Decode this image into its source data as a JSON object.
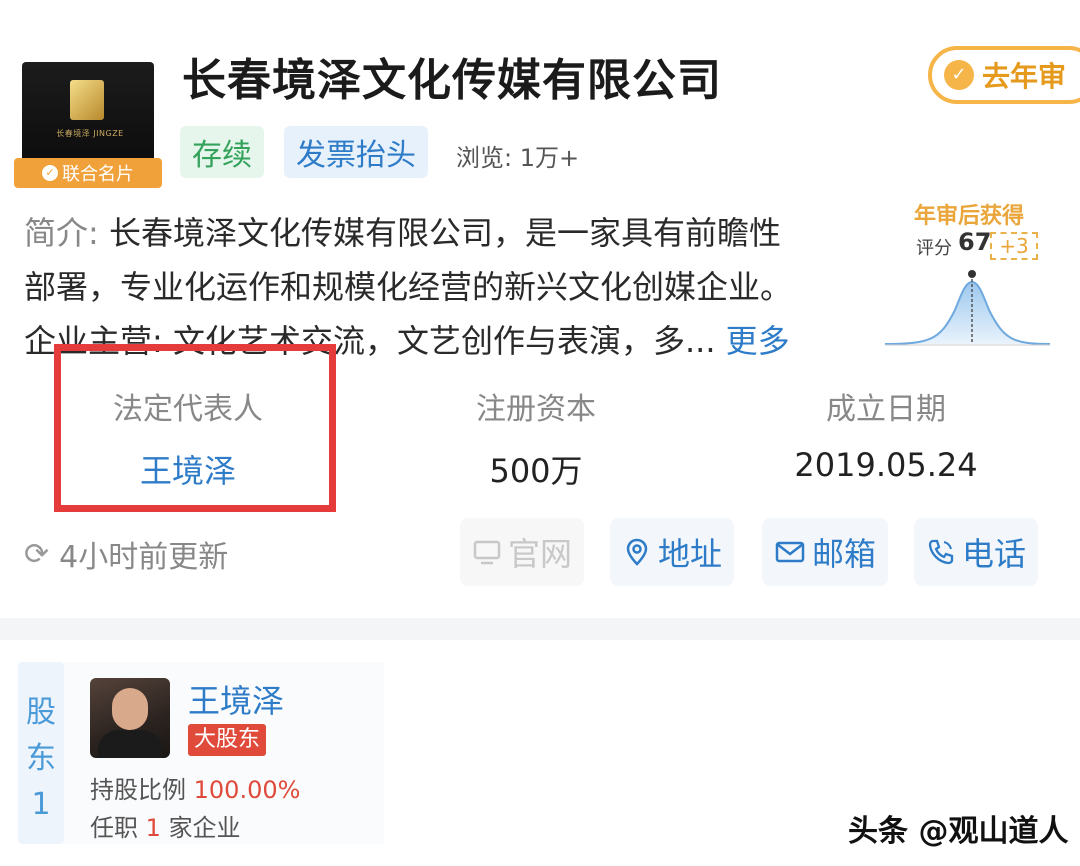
{
  "company": {
    "name": "长春境泽文化传媒有限公司",
    "logo_badge": "联合名片",
    "audit_badge": "去年审",
    "status_tag": "存续",
    "invoice_tag": "发票抬头",
    "views": "浏览: 1万+"
  },
  "intro": {
    "label": "简介:",
    "line1": "长春境泽文化传媒有限公司，是一家具有前瞻性",
    "line2": "部署，专业化运作和规模化经营的新兴文化创媒企业。",
    "line3_label": "企业主营:",
    "line3": "文化艺术交流，文艺创作与表演，多...",
    "more": "更多"
  },
  "score": {
    "title": "年审后获得",
    "label": "评分",
    "value": "67",
    "delta": "+3"
  },
  "stats": {
    "legal_rep_label": "法定代表人",
    "legal_rep_value": "王境泽",
    "capital_label": "注册资本",
    "capital_value": "500万",
    "founded_label": "成立日期",
    "founded_value": "2019.05.24"
  },
  "update": {
    "text": "4小时前更新"
  },
  "actions": {
    "site": "官网",
    "address": "地址",
    "mail": "邮箱",
    "phone": "电话"
  },
  "holder": {
    "side_tab": "股东1",
    "name": "王境泽",
    "badge": "大股东",
    "ratio_label": "持股比例",
    "ratio_value": "100.00%",
    "jobs_prefix": "任职",
    "jobs_count": "1",
    "jobs_suffix": "家企业"
  },
  "watermark": "头条 @观山道人",
  "colors": {
    "link_blue": "#2e7cc8",
    "highlight_red": "#e53b3b",
    "accent_orange": "#f5b548"
  }
}
